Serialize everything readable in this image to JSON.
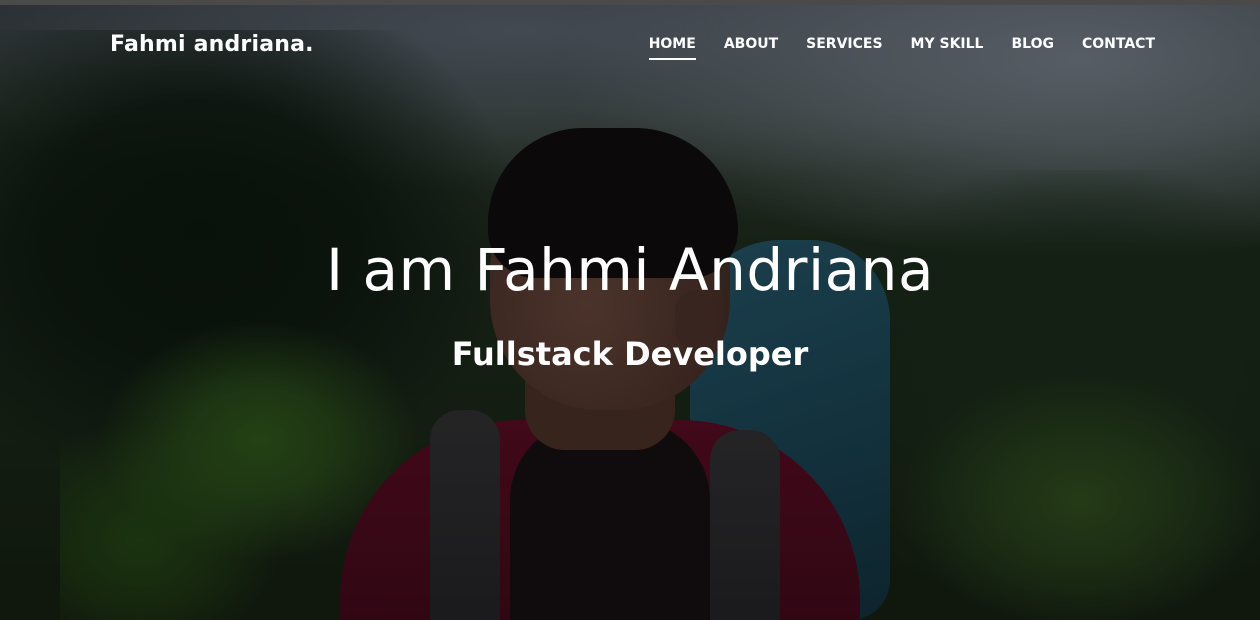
{
  "brand": {
    "name": "Fahmi andriana."
  },
  "nav": {
    "items": [
      {
        "label": "HOME",
        "active": true
      },
      {
        "label": "ABOUT",
        "active": false
      },
      {
        "label": "SERVICES",
        "active": false
      },
      {
        "label": "MY SKILL",
        "active": false
      },
      {
        "label": "BLOG",
        "active": false
      },
      {
        "label": "CONTACT",
        "active": false
      }
    ]
  },
  "hero": {
    "title": "I am Fahmi Andriana",
    "subtitle": "Fullstack Developer"
  },
  "colors": {
    "text": "#ffffff",
    "overlay": "#000000",
    "topbar": "#4a4a4a"
  }
}
